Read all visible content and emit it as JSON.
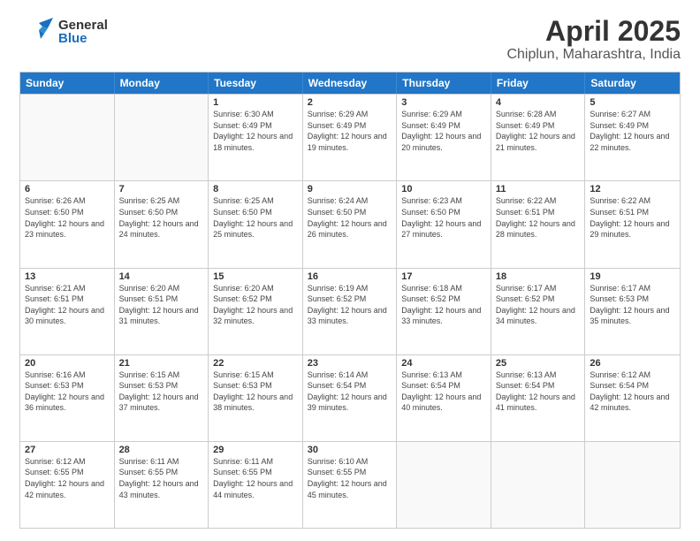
{
  "header": {
    "logo_general": "General",
    "logo_blue": "Blue",
    "title": "April 2025",
    "subtitle": "Chiplun, Maharashtra, India"
  },
  "calendar": {
    "days": [
      "Sunday",
      "Monday",
      "Tuesday",
      "Wednesday",
      "Thursday",
      "Friday",
      "Saturday"
    ],
    "weeks": [
      [
        {
          "day": "",
          "info": ""
        },
        {
          "day": "",
          "info": ""
        },
        {
          "day": "1",
          "info": "Sunrise: 6:30 AM\nSunset: 6:49 PM\nDaylight: 12 hours and 18 minutes."
        },
        {
          "day": "2",
          "info": "Sunrise: 6:29 AM\nSunset: 6:49 PM\nDaylight: 12 hours and 19 minutes."
        },
        {
          "day": "3",
          "info": "Sunrise: 6:29 AM\nSunset: 6:49 PM\nDaylight: 12 hours and 20 minutes."
        },
        {
          "day": "4",
          "info": "Sunrise: 6:28 AM\nSunset: 6:49 PM\nDaylight: 12 hours and 21 minutes."
        },
        {
          "day": "5",
          "info": "Sunrise: 6:27 AM\nSunset: 6:49 PM\nDaylight: 12 hours and 22 minutes."
        }
      ],
      [
        {
          "day": "6",
          "info": "Sunrise: 6:26 AM\nSunset: 6:50 PM\nDaylight: 12 hours and 23 minutes."
        },
        {
          "day": "7",
          "info": "Sunrise: 6:25 AM\nSunset: 6:50 PM\nDaylight: 12 hours and 24 minutes."
        },
        {
          "day": "8",
          "info": "Sunrise: 6:25 AM\nSunset: 6:50 PM\nDaylight: 12 hours and 25 minutes."
        },
        {
          "day": "9",
          "info": "Sunrise: 6:24 AM\nSunset: 6:50 PM\nDaylight: 12 hours and 26 minutes."
        },
        {
          "day": "10",
          "info": "Sunrise: 6:23 AM\nSunset: 6:50 PM\nDaylight: 12 hours and 27 minutes."
        },
        {
          "day": "11",
          "info": "Sunrise: 6:22 AM\nSunset: 6:51 PM\nDaylight: 12 hours and 28 minutes."
        },
        {
          "day": "12",
          "info": "Sunrise: 6:22 AM\nSunset: 6:51 PM\nDaylight: 12 hours and 29 minutes."
        }
      ],
      [
        {
          "day": "13",
          "info": "Sunrise: 6:21 AM\nSunset: 6:51 PM\nDaylight: 12 hours and 30 minutes."
        },
        {
          "day": "14",
          "info": "Sunrise: 6:20 AM\nSunset: 6:51 PM\nDaylight: 12 hours and 31 minutes."
        },
        {
          "day": "15",
          "info": "Sunrise: 6:20 AM\nSunset: 6:52 PM\nDaylight: 12 hours and 32 minutes."
        },
        {
          "day": "16",
          "info": "Sunrise: 6:19 AM\nSunset: 6:52 PM\nDaylight: 12 hours and 33 minutes."
        },
        {
          "day": "17",
          "info": "Sunrise: 6:18 AM\nSunset: 6:52 PM\nDaylight: 12 hours and 33 minutes."
        },
        {
          "day": "18",
          "info": "Sunrise: 6:17 AM\nSunset: 6:52 PM\nDaylight: 12 hours and 34 minutes."
        },
        {
          "day": "19",
          "info": "Sunrise: 6:17 AM\nSunset: 6:53 PM\nDaylight: 12 hours and 35 minutes."
        }
      ],
      [
        {
          "day": "20",
          "info": "Sunrise: 6:16 AM\nSunset: 6:53 PM\nDaylight: 12 hours and 36 minutes."
        },
        {
          "day": "21",
          "info": "Sunrise: 6:15 AM\nSunset: 6:53 PM\nDaylight: 12 hours and 37 minutes."
        },
        {
          "day": "22",
          "info": "Sunrise: 6:15 AM\nSunset: 6:53 PM\nDaylight: 12 hours and 38 minutes."
        },
        {
          "day": "23",
          "info": "Sunrise: 6:14 AM\nSunset: 6:54 PM\nDaylight: 12 hours and 39 minutes."
        },
        {
          "day": "24",
          "info": "Sunrise: 6:13 AM\nSunset: 6:54 PM\nDaylight: 12 hours and 40 minutes."
        },
        {
          "day": "25",
          "info": "Sunrise: 6:13 AM\nSunset: 6:54 PM\nDaylight: 12 hours and 41 minutes."
        },
        {
          "day": "26",
          "info": "Sunrise: 6:12 AM\nSunset: 6:54 PM\nDaylight: 12 hours and 42 minutes."
        }
      ],
      [
        {
          "day": "27",
          "info": "Sunrise: 6:12 AM\nSunset: 6:55 PM\nDaylight: 12 hours and 42 minutes."
        },
        {
          "day": "28",
          "info": "Sunrise: 6:11 AM\nSunset: 6:55 PM\nDaylight: 12 hours and 43 minutes."
        },
        {
          "day": "29",
          "info": "Sunrise: 6:11 AM\nSunset: 6:55 PM\nDaylight: 12 hours and 44 minutes."
        },
        {
          "day": "30",
          "info": "Sunrise: 6:10 AM\nSunset: 6:55 PM\nDaylight: 12 hours and 45 minutes."
        },
        {
          "day": "",
          "info": ""
        },
        {
          "day": "",
          "info": ""
        },
        {
          "day": "",
          "info": ""
        }
      ]
    ]
  }
}
